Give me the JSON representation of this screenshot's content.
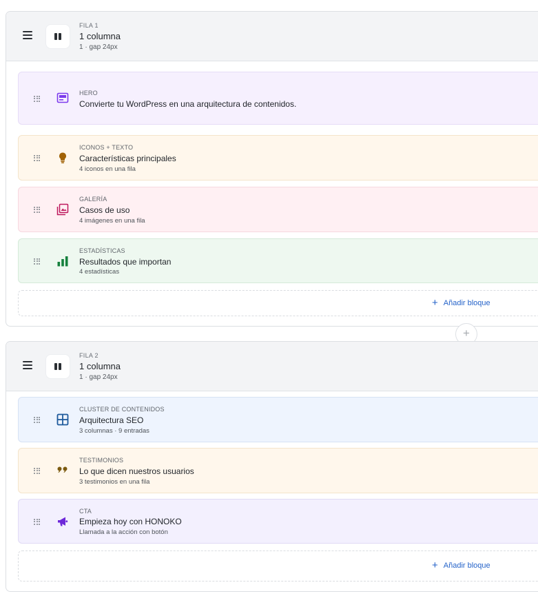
{
  "rows": [
    {
      "overline": "FILA 1",
      "title": "1 columna",
      "subtitle": "1 · gap 24px",
      "blocks": [
        {
          "type": "HERO",
          "title": "Convierte tu WordPress en una arquitectura de contenidos.",
          "subtitle": "",
          "icon": "hero-image-icon",
          "color": "#7c3aed"
        },
        {
          "type": "ICONOS + TEXTO",
          "title": "Características principales",
          "subtitle": "4 iconos en una fila",
          "icon": "lightbulb-icon",
          "color": "#a16207"
        },
        {
          "type": "GALERÍA",
          "title": "Casos de uso",
          "subtitle": "4 imágenes en una fila",
          "icon": "gallery-icon",
          "color": "#be185d"
        },
        {
          "type": "ESTADÍSTICAS",
          "title": "Resultados que importan",
          "subtitle": "4 estadísticas",
          "icon": "bar-chart-icon",
          "color": "#15803d"
        }
      ],
      "add_block_label": "Añadir bloque"
    },
    {
      "overline": "FILA 2",
      "title": "1 columna",
      "subtitle": "1 · gap 24px",
      "blocks": [
        {
          "type": "CLUSTER DE CONTENIDOS",
          "title": "Arquitectura SEO",
          "subtitle": "3 columnas · 9 entradas",
          "icon": "grid-icon",
          "color": "#1e5a9c"
        },
        {
          "type": "TESTIMONIOS",
          "title": "Lo que dicen nuestros usuarios",
          "subtitle": "3 testimonios en una fila",
          "icon": "quote-icon",
          "color": "#7c5a10"
        },
        {
          "type": "CTA",
          "title": "Empieza hoy con HONOKO",
          "subtitle": "Llamada a la acción con botón",
          "icon": "megaphone-icon",
          "color": "#6d28d9"
        }
      ],
      "add_block_label": "Añadir bloque"
    }
  ],
  "add_row_symbol": "+",
  "add_block_symbol": "+"
}
